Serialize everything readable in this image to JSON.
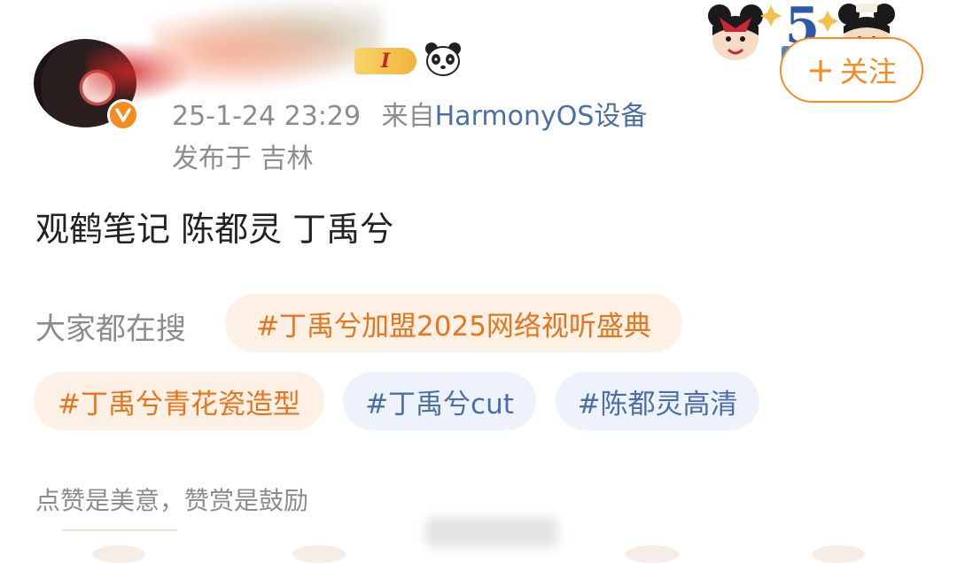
{
  "post": {
    "timestamp": "25-1-24 23:29",
    "source_prefix": "来自",
    "source_device": "HarmonyOS设备",
    "location": "发布于 吉林",
    "text": "观鹤笔记 陈都灵 丁禹兮"
  },
  "user": {
    "level_badge": "I",
    "verified_icon": "v-verified-icon",
    "panda_icon": "panda-icon"
  },
  "follow_button": {
    "plus": "+",
    "label": "关注"
  },
  "trending": {
    "label": "大家都在搜",
    "tags": [
      {
        "text": "#丁禹兮加盟2025网络视听盛典",
        "style": "hot"
      },
      {
        "text": "#丁禹兮青花瓷造型",
        "style": "hot"
      },
      {
        "text": "#丁禹兮cut",
        "style": "cool"
      },
      {
        "text": "#陈都灵高清",
        "style": "cool"
      }
    ]
  },
  "footer": {
    "note": "点赞是美意，赞赏是鼓励"
  },
  "colors": {
    "accent_orange": "#f68b1e",
    "link_blue": "#4a6ea9",
    "meta_gray": "#8c8c8c",
    "hot_tag_bg": "#fdf1e6",
    "cool_tag_bg": "#eef3fb"
  }
}
